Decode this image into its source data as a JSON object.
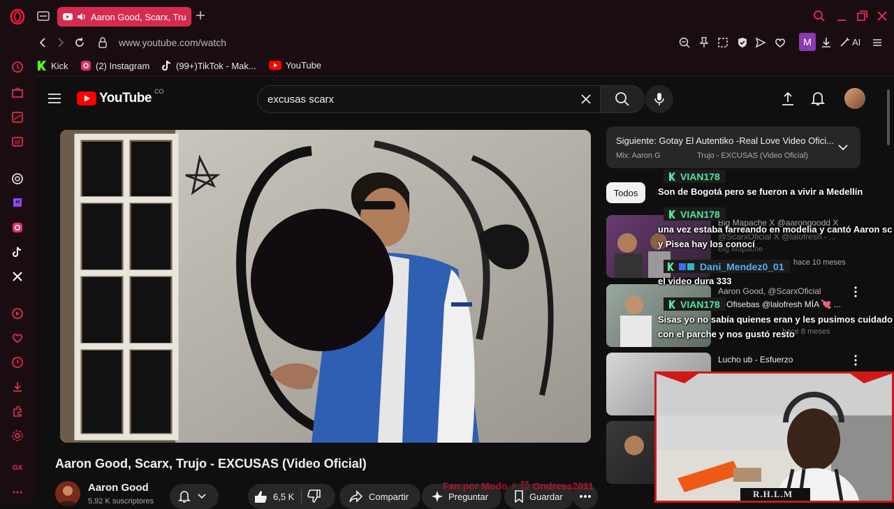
{
  "browser": {
    "tab": {
      "title": "Aaron Good, Scarx, Tru"
    },
    "address": {
      "url": "www.youtube.com/watch"
    },
    "extension_badge": "M",
    "ai_label": "AI",
    "bookmarks": [
      {
        "label": "Kick",
        "icon": "kick-icon"
      },
      {
        "label": "(2) Instagram",
        "icon": "instagram-icon"
      },
      {
        "label": "(99+)TikTok - Mak...",
        "icon": "tiktok-icon"
      },
      {
        "label": "YouTube",
        "icon": "youtube-icon"
      }
    ]
  },
  "youtube": {
    "logo_text": "YouTube",
    "country_code": "CO",
    "search": {
      "query": "excusas scarx"
    }
  },
  "video": {
    "title": "Aaron Good, Scarx, Trujo - EXCUSAS (Video Oficial)",
    "channel_name": "Aaron Good",
    "subscribers": "5,92 K suscriptores",
    "likes": "6,5 K",
    "share_label": "Compartir",
    "ask_label": "Preguntar",
    "save_label": "Guardar"
  },
  "playlist": {
    "next_label": "Siguiente: Gotay El Autentiko -Real Love Video Ofici...",
    "mix_label": "Mix: Aaron G",
    "mix_suffix": "Trujo - EXCUSAS (Video Oficial)"
  },
  "filters": {
    "all_label": "Todos"
  },
  "recommendations": [
    {
      "title": "Big Mapache X @aarongoodd X",
      "channel": "@ScarxOficial X @lalofresh - ...",
      "meta": "Big Mapache"
    },
    {
      "title": "Aaron Good, @ScarxOficial",
      "channel": "@Ofisebas @lalofresh MÍA 💘 ...",
      "meta": "hace 10 meses"
    },
    {
      "title": "Lucho ub - Esfuerzo",
      "channel": "",
      "meta": "hace 8 meses"
    }
  ],
  "chat": [
    {
      "user": "VIAN178",
      "message": "Son de Bogotá pero se fueron a vivir a Medellín"
    },
    {
      "user": "VIAN178",
      "message": "una vez estaba farreando en modelia y cantó Aaron sc",
      "message2": "y Pisea hay los conocí"
    },
    {
      "user": "Dani_Mendez0_01",
      "message": "el video dura 333"
    },
    {
      "user": "VIAN178",
      "message": "Sisas yo no sabía quienes eran y les pusimos cuidado",
      "message2": "con el parche y nos gustó resto"
    }
  ],
  "overlay": {
    "streamer_tag": "R.H.L.M",
    "fan_text": "Fan por Modo ⚡ 😈 Ondress2011"
  },
  "colors": {
    "opera_red": "#ff1b2d",
    "chat_name": "#57e39e",
    "youtube_red": "#ff0000",
    "tab_active": "#d62b4f"
  }
}
